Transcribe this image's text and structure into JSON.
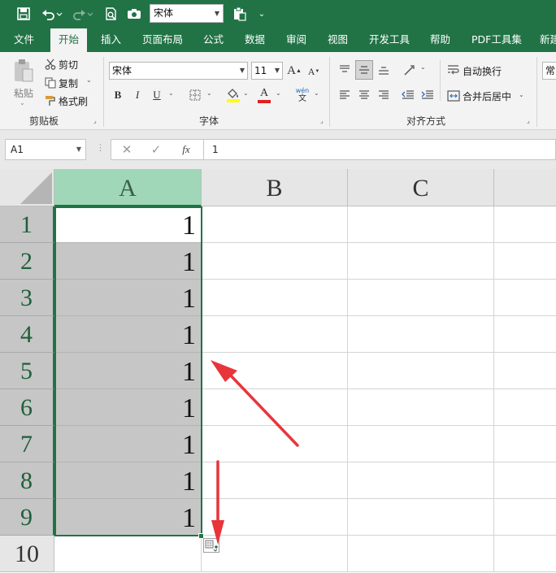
{
  "quick_access": {
    "font_value": "宋体",
    "save_icon": "save-icon",
    "undo_icon": "undo-icon",
    "redo_icon": "redo-icon",
    "print_preview_icon": "print-preview-icon",
    "camera_icon": "camera-icon",
    "paste_icon": "paste-icon",
    "customize_icon": "customize-icon"
  },
  "tabs": [
    "文件",
    "开始",
    "插入",
    "页面布局",
    "公式",
    "数据",
    "审阅",
    "视图",
    "开发工具",
    "帮助",
    "PDF工具集",
    "新建"
  ],
  "active_tab": "开始",
  "ribbon": {
    "clipboard": {
      "label": "剪贴板",
      "paste": "粘贴",
      "cut": "剪切",
      "copy": "复制",
      "format_painter": "格式刷"
    },
    "font": {
      "label": "字体",
      "font_name": "宋体",
      "font_size": "11",
      "grow": "A",
      "shrink": "A",
      "bold": "B",
      "italic": "I",
      "underline": "U",
      "font_color_letter": "A",
      "phonetic_top": "wén",
      "phonetic_bottom": "文"
    },
    "alignment": {
      "label": "对齐方式",
      "wrap_text": "自动换行",
      "merge_center": "合并后居中"
    },
    "number": {
      "format_value": "常"
    }
  },
  "formula_bar": {
    "name_box": "A1",
    "fx_label": "fx",
    "content": "1"
  },
  "sheet": {
    "columns": [
      "A",
      "B",
      "C"
    ],
    "selected_column": "A",
    "rows": [
      "1",
      "2",
      "3",
      "4",
      "5",
      "6",
      "7",
      "8",
      "9",
      "10"
    ],
    "column_a_values": [
      "1",
      "1",
      "1",
      "1",
      "1",
      "1",
      "1",
      "1",
      "1",
      ""
    ]
  },
  "colors": {
    "brand_green": "#217346",
    "selected_header": "#a0d7b8",
    "selection_fill": "#c6c6c6",
    "annotation_arrow": "#e8353b"
  }
}
